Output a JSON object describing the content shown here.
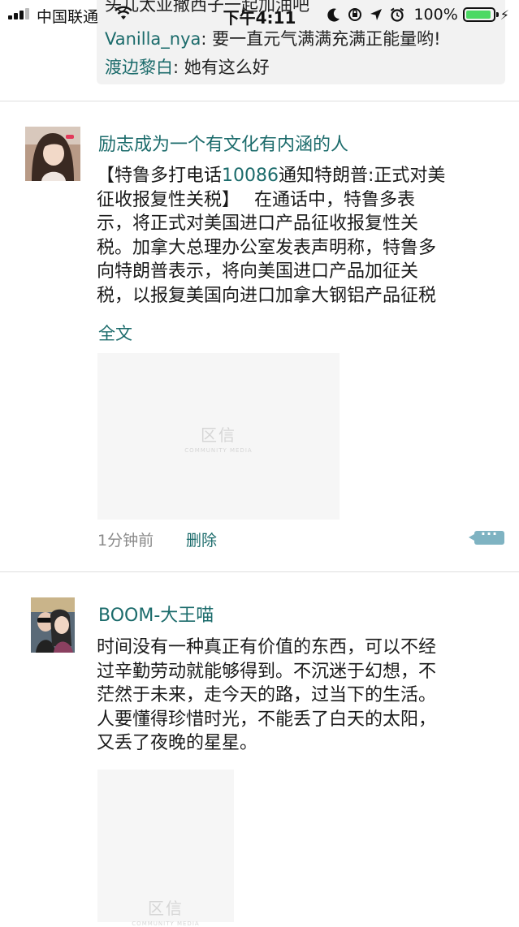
{
  "status_bar": {
    "carrier": "中国联通",
    "time": "下午4:11",
    "battery_percent": "100%",
    "battery_level": 1.0,
    "battery_color": "#4cd964"
  },
  "top_comments": {
    "scrolled_partial": "头儿太亚撒西子一起加油吧",
    "items": [
      {
        "author": "Vanilla_nya",
        "text": ": 要一直元气满满充满正能量哟!"
      },
      {
        "author": "渡边黎白",
        "text": ": 她有这么好"
      }
    ]
  },
  "posts": [
    {
      "author": "励志成为一个有文化有内涵的人",
      "text_lines": [
        {
          "pre": "【特鲁多打电话",
          "highlight": "10086",
          "post": "通知特朗普:正式对美"
        },
        {
          "pre": "征收报复性关税】　 在通话中，特鲁多表",
          "highlight": "",
          "post": ""
        },
        {
          "pre": "示，将正式对美国进口产品征收报复性关",
          "highlight": "",
          "post": ""
        },
        {
          "pre": "税。加拿大总理办公室发表声明称，特鲁多",
          "highlight": "",
          "post": ""
        },
        {
          "pre": "向特朗普表示，将向美国进口产品加征关",
          "highlight": "",
          "post": ""
        },
        {
          "pre": "税，以报复美国向进口加拿大钢铝产品征税",
          "highlight": "",
          "post": ""
        }
      ],
      "full_text_link": "全文",
      "watermark_main": "区信",
      "watermark_sub": "COMMUNITY MEDIA",
      "time": "1分钟前",
      "delete_label": "删除"
    },
    {
      "author": "BOOM-大王喵",
      "text_lines": [
        {
          "pre": "时间没有一种真正有价值的东西，可以不经",
          "highlight": "",
          "post": ""
        },
        {
          "pre": "过辛勤劳动就能够得到。不沉迷于幻想，不",
          "highlight": "",
          "post": ""
        },
        {
          "pre": "茫然于未来，走今天的路，过当下的生活。",
          "highlight": "",
          "post": ""
        },
        {
          "pre": "人要懂得珍惜时光，不能丢了白天的太阳，",
          "highlight": "",
          "post": ""
        },
        {
          "pre": "又丢了夜晚的星星。",
          "highlight": "",
          "post": ""
        }
      ],
      "watermark_main": "区信",
      "watermark_sub": "COMMUNITY MEDIA"
    }
  ],
  "colors": {
    "accent": "#1b6b6b",
    "more_button": "#7fb3c2",
    "comment_bg": "#f2f2f2"
  }
}
